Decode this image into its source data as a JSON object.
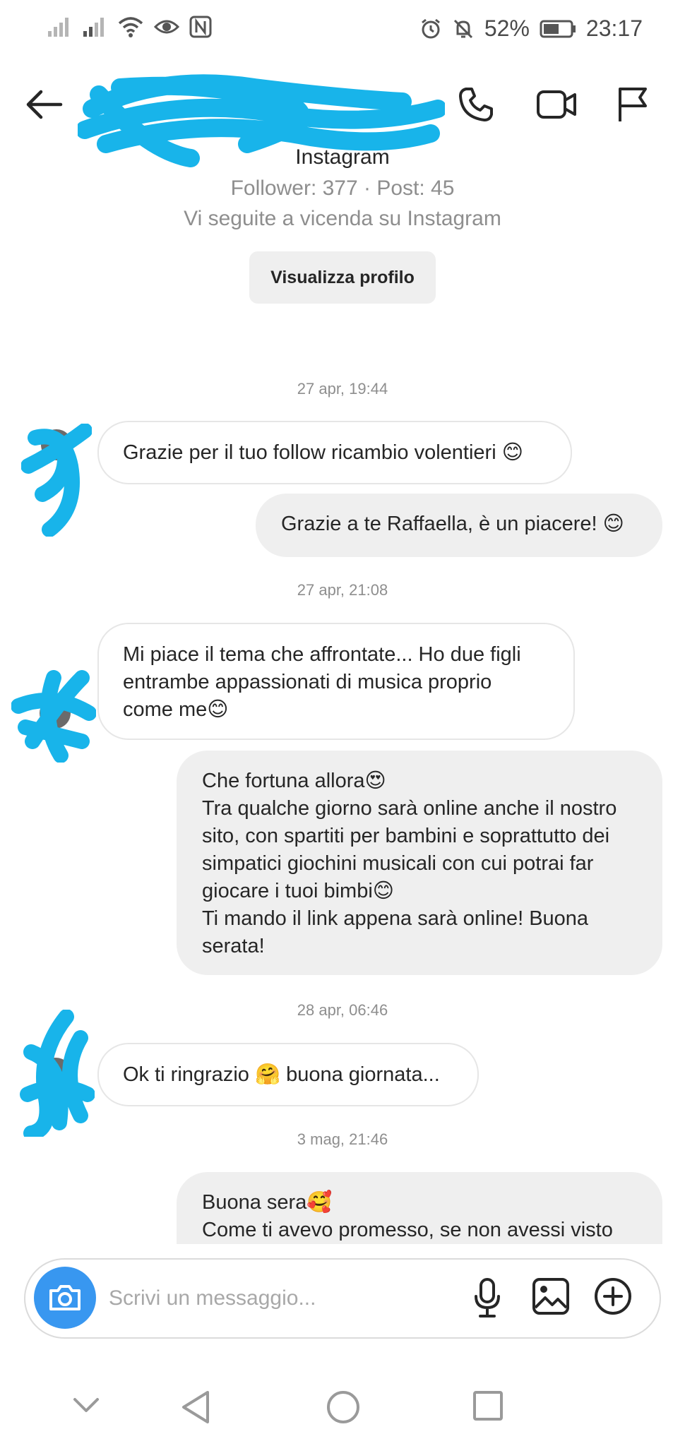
{
  "status_bar": {
    "battery": "52%",
    "time": "23:17",
    "icons": [
      "signal-icon",
      "signal-icon",
      "wifi-icon",
      "eye-icon",
      "nfc-icon",
      "alarm-icon",
      "mute-icon",
      "battery-icon"
    ]
  },
  "header": {
    "icons": [
      "back-arrow-icon",
      "phone-icon",
      "video-call-icon",
      "flag-icon"
    ]
  },
  "profile": {
    "name": "Instagram",
    "stats": "Follower: 377 · Post: 45",
    "mutual": "Vi seguite a vicenda su Instagram",
    "view_profile_label": "Visualizza profilo"
  },
  "messages": [
    {
      "type": "timestamp",
      "text": "27 apr, 19:44"
    },
    {
      "type": "incoming",
      "lines": [
        "Grazie per il tuo follow ricambio volentieri 😊"
      ]
    },
    {
      "type": "outgoing",
      "lines": [
        "Grazie a te Raffaella, è un piacere! 😊"
      ]
    },
    {
      "type": "timestamp",
      "text": "27 apr, 21:08"
    },
    {
      "type": "incoming",
      "lines": [
        "Mi piace il tema che affrontate... Ho due figli",
        "entrambe appassionati di musica proprio",
        "come me😊"
      ]
    },
    {
      "type": "outgoing",
      "lines": [
        "Che fortuna allora😍",
        "Tra qualche giorno sarà online anche il nostro",
        "sito, con spartiti per bambini e soprattutto dei",
        "simpatici giochini musicali con cui potrai far",
        "giocare i tuoi bimbi😊",
        "Ti mando il link appena sarà online! Buona",
        "serata!"
      ]
    },
    {
      "type": "timestamp",
      "text": "28 apr, 06:46"
    },
    {
      "type": "incoming",
      "lines": [
        "Ok ti ringrazio 🤗 buona giornata..."
      ]
    },
    {
      "type": "timestamp",
      "text": "3 mag, 21:46"
    },
    {
      "type": "outgoing",
      "lines": [
        "Buona sera🥰",
        "Come ti avevo promesso, se non avessi visto"
      ]
    }
  ],
  "composer": {
    "placeholder": "Scrivi un messaggio...",
    "icons": [
      "camera-icon",
      "microphone-icon",
      "gallery-icon",
      "plus-icon"
    ]
  },
  "nav_bar": {
    "icons": [
      "chevron-down-icon",
      "back-triangle-icon",
      "home-circle-icon",
      "recents-square-icon"
    ]
  },
  "colors": {
    "accent": "#3897f0",
    "scribble": "#18b4ea",
    "outgoing_bubble": "#efefef",
    "muted_text": "#8e8e8e"
  }
}
